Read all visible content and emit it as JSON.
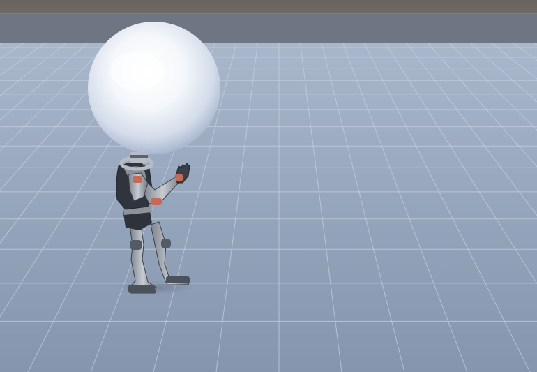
{
  "scene": {
    "type": "3d-game-viewport",
    "colors": {
      "sky_top": "#6a6460",
      "horizon_band": "#6f7683",
      "floor_far": "#a8b6cb",
      "floor_near": "#8393ab",
      "grid_line": "#c4d0df",
      "sphere_highlight": "#ffffff",
      "sphere_shade": "#aebcd3",
      "robot_body": "#3a3f4a",
      "robot_metal": "#a6abb4",
      "robot_accent": "#c46a55"
    },
    "objects": [
      {
        "name": "ground-plane-grid",
        "description_icon": "grid-floor"
      },
      {
        "name": "white-sphere",
        "description_icon": "sphere"
      },
      {
        "name": "robot-character",
        "description_icon": "humanoid-robot"
      }
    ]
  }
}
